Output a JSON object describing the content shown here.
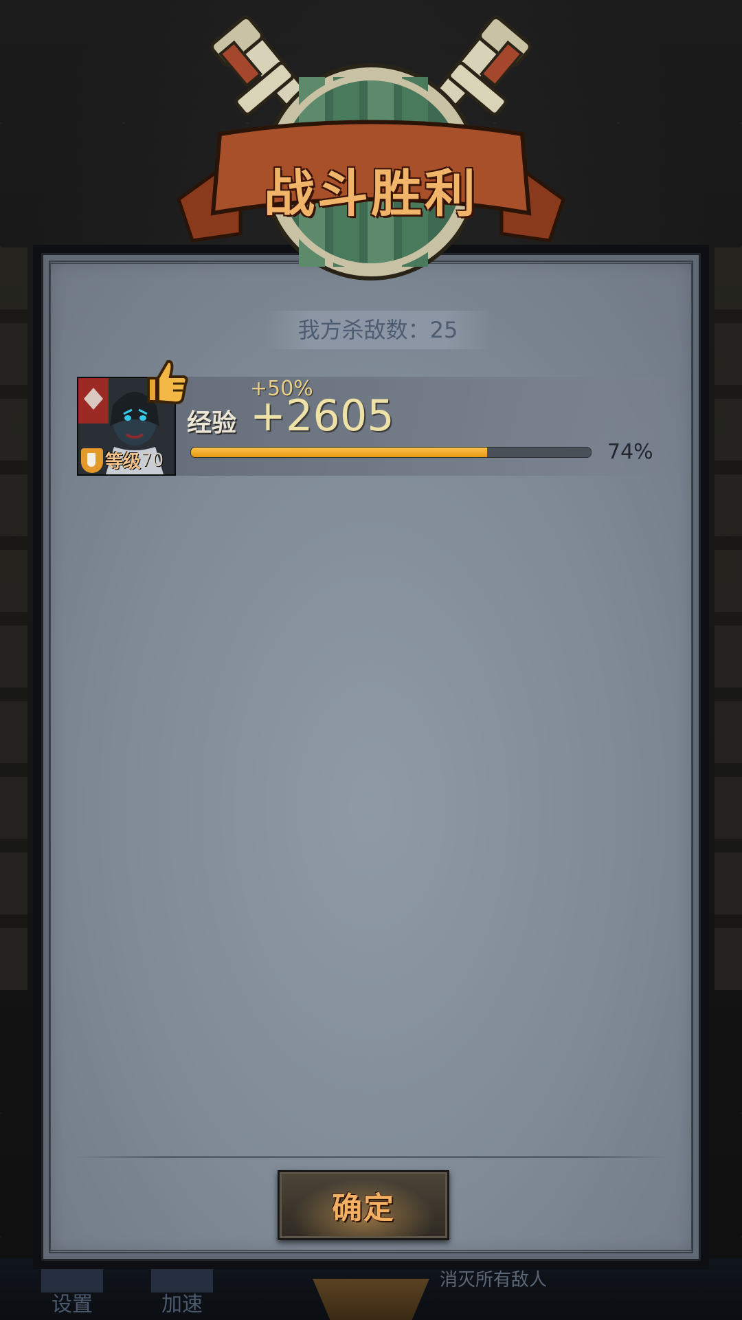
{
  "title": "战斗胜利",
  "kill_count_label": "我方杀敌数：25",
  "hero": {
    "level_label": "等级",
    "level_value": "70",
    "exp_label": "经验",
    "exp_gain": "+2605",
    "exp_bonus": "+50%",
    "progress_percent_text": "74%",
    "progress_fraction": 0.74
  },
  "confirm_label": "确定",
  "bottom_bar": {
    "settings_label": "设置",
    "speed_label": "加速",
    "kill_all_label": "消灭所有敌人"
  },
  "colors": {
    "title": "#f1b56a",
    "progress_fill": "#e69a12",
    "panel": "#8f9aa6"
  }
}
